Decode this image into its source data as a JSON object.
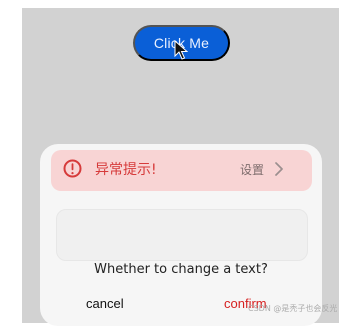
{
  "page": {
    "primary_button_label": "Click Me"
  },
  "dialog": {
    "alert_title": "异常提示!",
    "settings_label": "设置",
    "message": "Whether to change a text?",
    "cancel_label": "cancel",
    "confirm_label": "confirm"
  },
  "overlay": {
    "watermark": "CSDN @是秃子也会反光"
  },
  "icons": {
    "alert": "exclamation-circle-icon",
    "chevron": "chevron-right-icon",
    "cursor": "mouse-cursor-icon"
  },
  "colors": {
    "primary_button": "#0a5fd7",
    "alert_bg": "#f8d4d4",
    "alert_text": "#d63a3a",
    "confirm_text": "#d62020",
    "background": "#d2d2d2",
    "dialog_bg": "#f6f6f6"
  }
}
